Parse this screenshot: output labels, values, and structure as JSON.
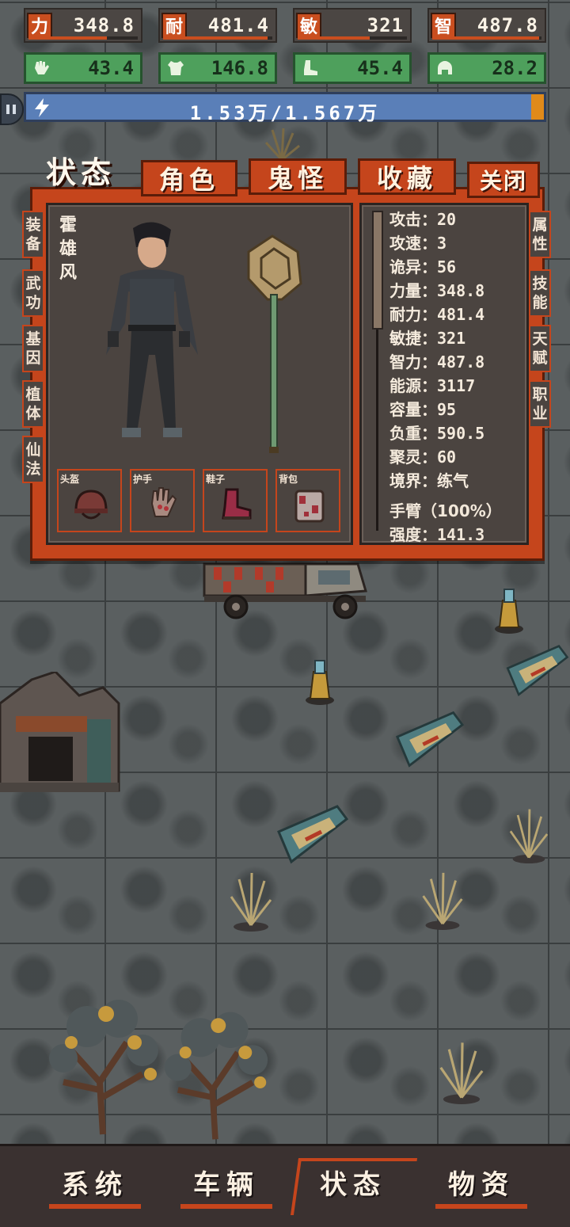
{
  "top_stats": [
    {
      "key": "力",
      "value": "348.8",
      "fill": 0.72
    },
    {
      "key": "耐",
      "value": "481.4",
      "fill": 0.96
    },
    {
      "key": "敏",
      "value": "321",
      "fill": 0.66
    },
    {
      "key": "智",
      "value": "487.8",
      "fill": 0.98
    }
  ],
  "defense_stats": [
    {
      "icon": "glove-icon",
      "value": "43.4"
    },
    {
      "icon": "armor-icon",
      "value": "146.8"
    },
    {
      "icon": "boot-icon",
      "value": "45.4"
    },
    {
      "icon": "helmet-icon",
      "value": "28.2"
    }
  ],
  "energy": {
    "text": "1.53万/1.567万",
    "fill": 0.976
  },
  "tabs": {
    "status": "状态",
    "role": "角色",
    "ghost": "鬼怪",
    "collect": "收藏",
    "close": "关闭"
  },
  "left_tabs": [
    "装备",
    "武功",
    "基因",
    "植体",
    "仙法"
  ],
  "right_tabs": [
    "属性",
    "技能",
    "天赋",
    "职业"
  ],
  "character": {
    "name": "霍雄风"
  },
  "slots": [
    {
      "label": "头盔",
      "icon": "helmet-icon"
    },
    {
      "label": "护手",
      "icon": "gauntlet-icon"
    },
    {
      "label": "鞋子",
      "icon": "boots-icon"
    },
    {
      "label": "背包",
      "icon": "backpack-icon"
    }
  ],
  "attributes": [
    {
      "name": "攻击",
      "value": "20"
    },
    {
      "name": "攻速",
      "value": "3"
    },
    {
      "name": "诡异",
      "value": "56"
    },
    {
      "name": "力量",
      "value": "348.8"
    },
    {
      "name": "耐力",
      "value": "481.4"
    },
    {
      "name": "敏捷",
      "value": "321"
    },
    {
      "name": "智力",
      "value": "487.8"
    },
    {
      "name": "能源",
      "value": "3117"
    },
    {
      "name": "容量",
      "value": "95"
    },
    {
      "name": "负重",
      "value": "590.5"
    },
    {
      "name": "聚灵",
      "value": "60"
    },
    {
      "name": "境界",
      "value": "练气"
    }
  ],
  "arm": {
    "title": "手臂（100%）",
    "name": "强度",
    "value": "141.3"
  },
  "bottom_nav": [
    "系统",
    "车辆",
    "状态",
    "物资"
  ],
  "colors": {
    "accent": "#c5451c",
    "panel": "#4b4440",
    "green": "#4ea05c",
    "energy": "#5a7fb8"
  }
}
